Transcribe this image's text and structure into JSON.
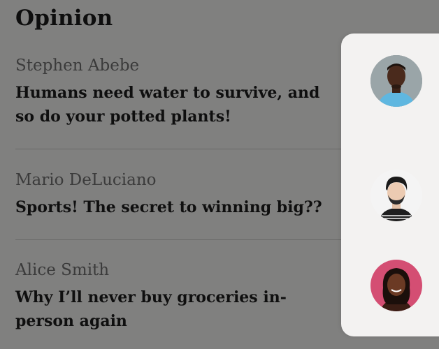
{
  "section": {
    "title": "Opinion"
  },
  "articles": [
    {
      "author": "Stephen Abebe",
      "headline": "Humans need water to survive, and so do your potted plants!",
      "avatar": "man-portrait-avatar"
    },
    {
      "author": "Mario DeLuciano",
      "headline": "Sports! The secret to winning big??",
      "avatar": "bearded-man-avatar"
    },
    {
      "author": "Alice Smith",
      "headline": "Why I’ll never buy groceries in-person again",
      "avatar": "woman-portrait-avatar"
    }
  ],
  "colors": {
    "overlay": "#000000",
    "panel": "#f3f2f1",
    "divider": "#c9c7c5"
  }
}
